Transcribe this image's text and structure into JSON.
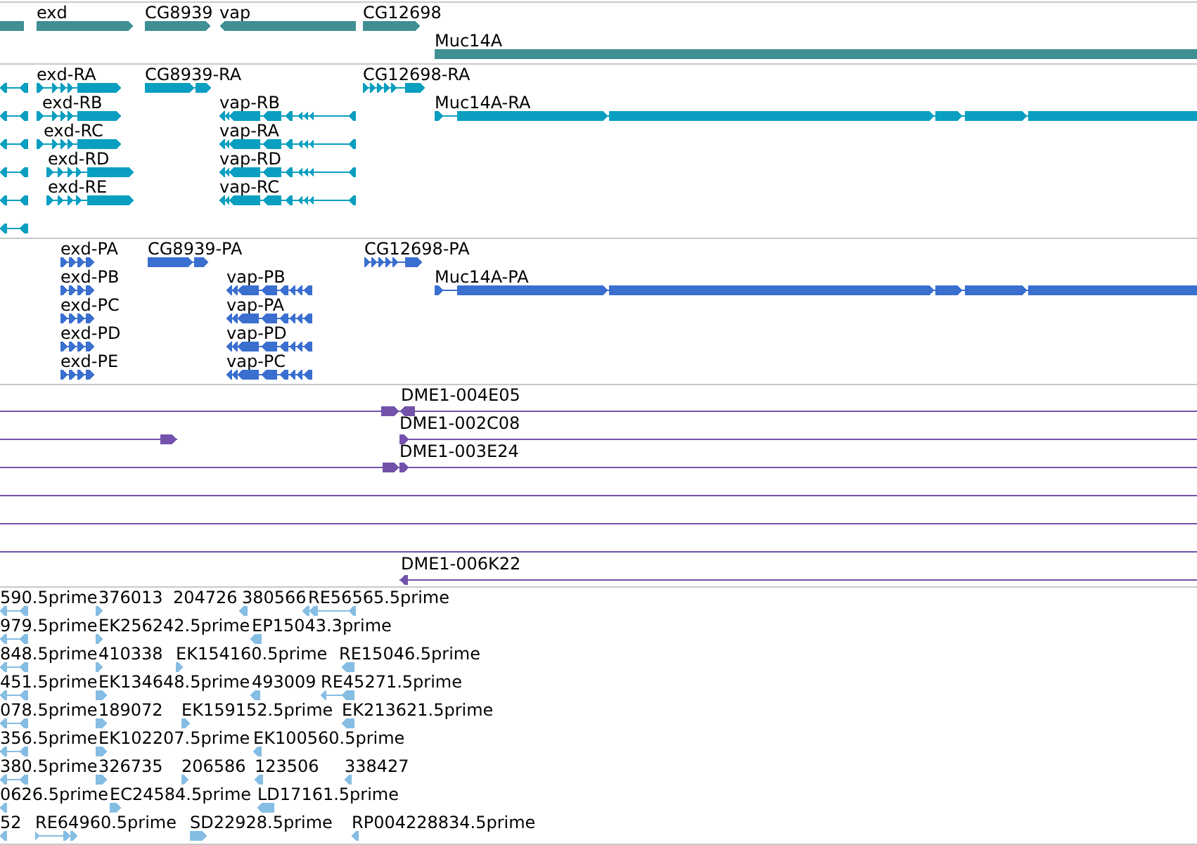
{
  "tracks": [
    {
      "kind": "genes",
      "features": [
        {
          "reverse": true
        },
        {
          "label": "exd",
          "reverse": false
        },
        {
          "label": "CG8939",
          "reverse": false
        },
        {
          "label": "vap",
          "reverse": true
        },
        {
          "label": "CG12698",
          "reverse": false
        },
        {
          "label": "Muc14A",
          "reverse": false
        }
      ]
    },
    {
      "kind": "transcripts",
      "features": [
        {
          "reverse": true
        },
        {
          "label": "exd-RA",
          "reverse": false
        },
        {
          "label": "CG8939-RA",
          "reverse": false
        },
        {
          "label": "CG12698-RA",
          "reverse": false
        },
        {
          "reverse": true
        },
        {
          "label": "exd-RB",
          "reverse": false
        },
        {
          "label": "vap-RB",
          "reverse": true
        },
        {
          "label": "Muc14A-RA",
          "reverse": false
        },
        {
          "reverse": true
        },
        {
          "label": "exd-RC",
          "reverse": false
        },
        {
          "label": "vap-RA",
          "reverse": true
        },
        {
          "reverse": true
        },
        {
          "label": "exd-RD",
          "reverse": false
        },
        {
          "label": "vap-RD",
          "reverse": true
        },
        {
          "reverse": true
        },
        {
          "label": "exd-RE",
          "reverse": false
        },
        {
          "label": "vap-RC",
          "reverse": true
        },
        {
          "reverse": true
        }
      ]
    },
    {
      "kind": "proteins",
      "features": [
        {
          "label": "exd-PA",
          "reverse": false
        },
        {
          "label": "CG8939-PA",
          "reverse": false
        },
        {
          "label": "CG12698-PA",
          "reverse": false
        },
        {
          "label": "exd-PB",
          "reverse": false
        },
        {
          "label": "vap-PB",
          "reverse": true
        },
        {
          "label": "Muc14A-PA",
          "reverse": false
        },
        {
          "label": "exd-PC",
          "reverse": false
        },
        {
          "label": "vap-PA",
          "reverse": true
        },
        {
          "label": "exd-PD",
          "reverse": false
        },
        {
          "label": "vap-PD",
          "reverse": true
        },
        {
          "label": "exd-PE",
          "reverse": false
        },
        {
          "label": "vap-PC",
          "reverse": true
        }
      ]
    },
    {
      "kind": "clones",
      "features": [
        {
          "kind": "marked",
          "reverse": false
        },
        {
          "label": "DME1-004E05",
          "kind": "marked",
          "reverse": true
        },
        {
          "kind": "marked",
          "reverse": false
        },
        {
          "label": "DME1-002C08",
          "kind": "marked",
          "reverse": false
        },
        {
          "kind": "marked",
          "reverse": false
        },
        {
          "label": "DME1-003E24",
          "kind": "marked",
          "reverse": false
        },
        {
          "kind": "plain"
        },
        {
          "kind": "plain"
        },
        {
          "kind": "plain"
        },
        {
          "label": "DME1-006K22",
          "kind": "marked",
          "reverse": true
        }
      ]
    },
    {
      "kind": "ests",
      "features": [
        {
          "label": "590.5prime",
          "reverse": true
        },
        {
          "label": "376013",
          "reverse": false
        },
        {
          "label": "204726"
        },
        {
          "label": "380566",
          "reverse": true
        },
        {
          "label": "RE56565.5prime",
          "reverse": true
        },
        {
          "label": "979.5prime",
          "reverse": true
        },
        {
          "label": "EK256242.5prime",
          "reverse": false
        },
        {
          "label": "EP15043.3prime",
          "reverse": true
        },
        {
          "label": "848.5prime",
          "reverse": true
        },
        {
          "label": "410338",
          "reverse": false
        },
        {
          "label": "EK154160.5prime",
          "reverse": false
        },
        {
          "label": "RE15046.5prime",
          "reverse": true
        },
        {
          "label": "451.5prime",
          "reverse": true
        },
        {
          "label": "EK134648.5prime",
          "reverse": false
        },
        {
          "label": "493009",
          "reverse": true
        },
        {
          "label": "RE45271.5prime",
          "reverse": true
        },
        {
          "label": "078.5prime",
          "reverse": true
        },
        {
          "label": "189072",
          "reverse": false
        },
        {
          "label": "EK159152.5prime",
          "reverse": false
        },
        {
          "label": "EK213621.5prime",
          "reverse": true
        },
        {
          "label": "356.5prime",
          "reverse": true
        },
        {
          "label": "EK102207.5prime",
          "reverse": false
        },
        {
          "label": "EK100560.5prime",
          "reverse": true
        },
        {
          "label": "380.5prime",
          "reverse": true
        },
        {
          "label": "326735",
          "reverse": false
        },
        {
          "label": "206586",
          "reverse": false
        },
        {
          "label": "123506",
          "reverse": true
        },
        {
          "label": "338427",
          "reverse": true
        },
        {
          "label": "0626.5prime",
          "reverse": true
        },
        {
          "label": "EC24584.5prime",
          "reverse": false
        },
        {
          "label": "LD17161.5prime",
          "reverse": true
        },
        {
          "label": "52",
          "reverse": true
        },
        {
          "label": "RE64960.5prime",
          "reverse": false
        },
        {
          "label": "SD22928.5prime",
          "reverse": false
        },
        {
          "label": "RP004228834.5prime",
          "reverse": true
        }
      ]
    }
  ]
}
